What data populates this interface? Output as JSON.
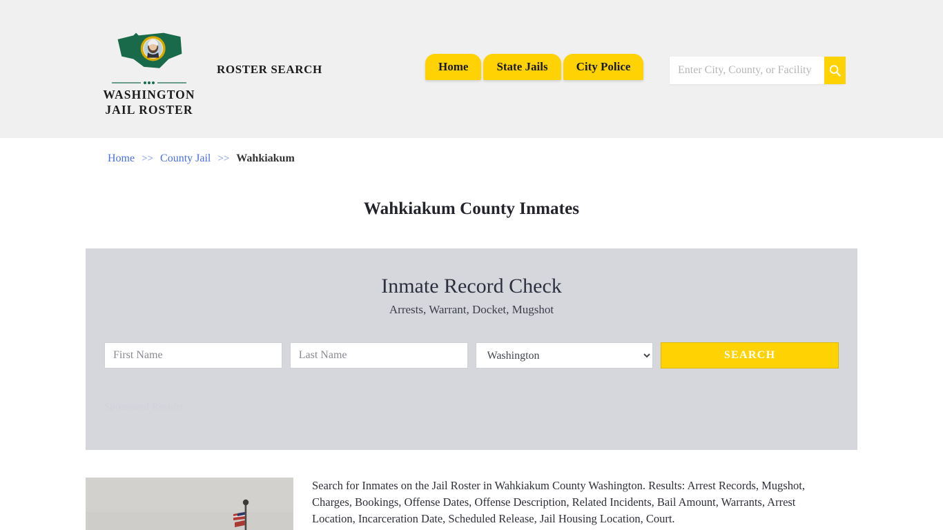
{
  "site": {
    "logo_line1": "WASHINGTON",
    "logo_line2": "JAIL ROSTER",
    "logo_icon": "washington-state-seal-icon",
    "tagline": "ROSTER SEARCH"
  },
  "header": {
    "nav": [
      {
        "label": "Home"
      },
      {
        "label": "State Jails"
      },
      {
        "label": "City Police"
      }
    ],
    "search": {
      "placeholder": "Enter City, County, or Facility",
      "value": "",
      "button_icon": "search-icon"
    }
  },
  "breadcrumb": {
    "items": [
      {
        "label": "Home",
        "link": true
      },
      {
        "label": "County Jail",
        "link": true
      },
      {
        "label": "Wahkiakum",
        "link": false
      }
    ],
    "separator": ">>"
  },
  "page": {
    "title": "Wahkiakum County Inmates"
  },
  "record_check": {
    "title": "Inmate Record Check",
    "subtitle": "Arrests, Warrant, Docket, Mugshot",
    "first_name_placeholder": "First Name",
    "first_name_value": "",
    "last_name_placeholder": "Last Name",
    "last_name_value": "",
    "state_selected": "Washington",
    "state_options": [
      "Washington"
    ],
    "search_button": "SEARCH",
    "sponsored_label": "Sponsored Results"
  },
  "description": {
    "photo_alt": "jail-building-with-flagpole-photo",
    "text": "Search for Inmates on the Jail Roster in Wahkiakum County Washington. Results: Arrest Records, Mugshot, Charges, Bookings, Offense Dates, Offense Description, Related Incidents, Bail Amount, Warrants, Arrest Location, Incarceration Date, Scheduled Release, Jail Housing Location, Court."
  },
  "colors": {
    "gold": "#ffd204",
    "header_bg": "#f0f0f0",
    "panel_bg": "#d6d6dd",
    "link_blue": "#4a6fe3",
    "logo_green": "#186a4a"
  }
}
